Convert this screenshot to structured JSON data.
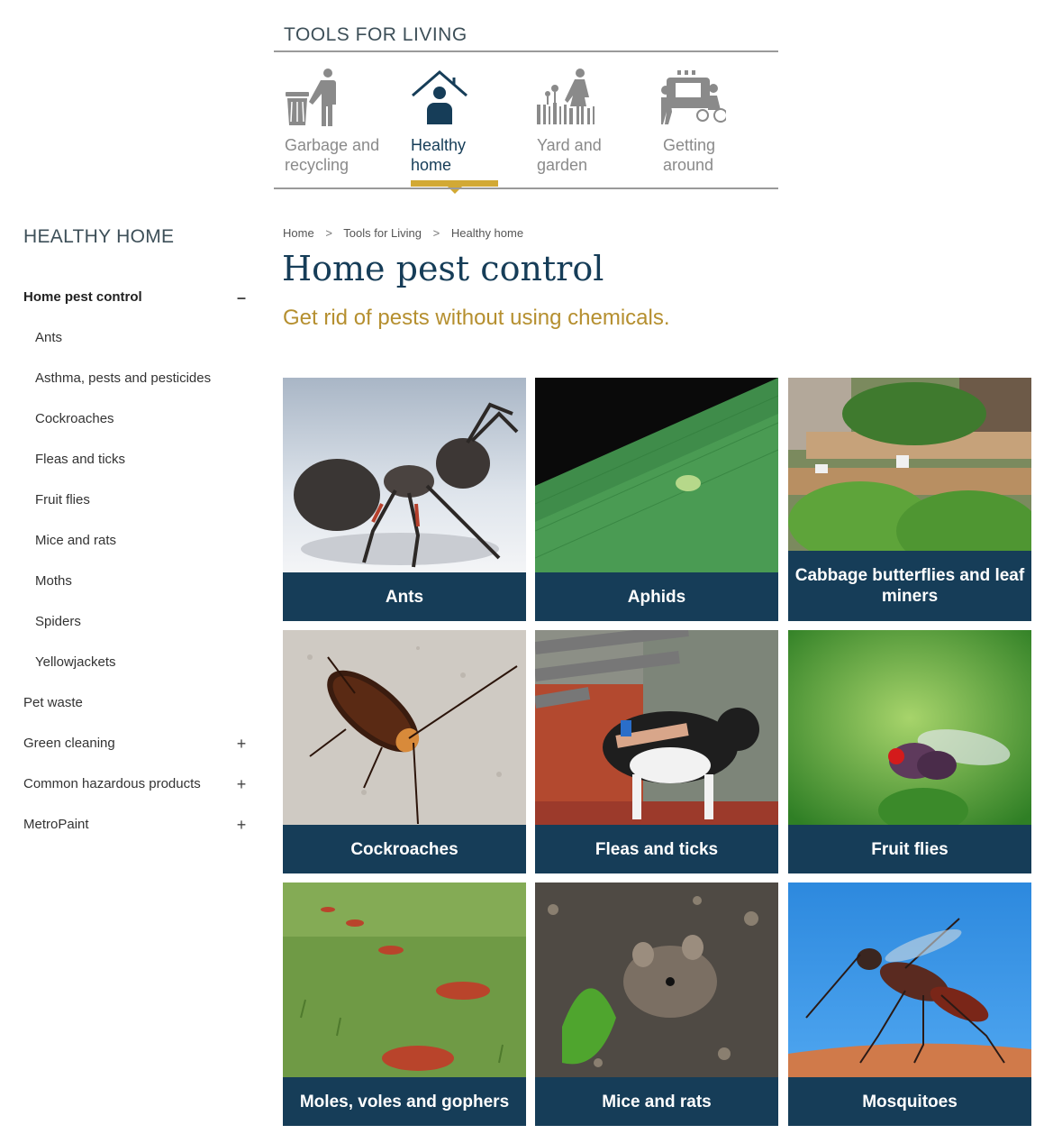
{
  "nav": {
    "title": "TOOLS FOR LIVING",
    "items": [
      {
        "label": "Garbage and\nrecycling",
        "icon": "garbage-recycling-icon"
      },
      {
        "label": "Healthy\nhome",
        "icon": "healthy-home-icon",
        "active": true
      },
      {
        "label": "Yard and\ngarden",
        "icon": "yard-garden-icon"
      },
      {
        "label": "Getting\naround",
        "icon": "getting-around-icon"
      }
    ]
  },
  "sidebar": {
    "title": "HEALTHY HOME",
    "items": [
      {
        "label": "Home pest control",
        "toggle": "–"
      },
      {
        "label": "Ants"
      },
      {
        "label": "Asthma, pests and pesticides"
      },
      {
        "label": "Cockroaches"
      },
      {
        "label": "Fleas and ticks"
      },
      {
        "label": "Fruit flies"
      },
      {
        "label": "Mice and rats"
      },
      {
        "label": "Moths"
      },
      {
        "label": "Spiders"
      },
      {
        "label": "Yellowjackets"
      },
      {
        "label": "Pet waste"
      },
      {
        "label": "Green cleaning",
        "toggle": "+"
      },
      {
        "label": "Common hazardous products",
        "toggle": "+"
      },
      {
        "label": "MetroPaint",
        "toggle": "+"
      }
    ]
  },
  "breadcrumb": {
    "items": [
      "Home",
      "Tools for Living",
      "Healthy home"
    ],
    "separator": ">"
  },
  "page": {
    "title": "Home pest control",
    "subtitle": "Get rid of pests without using chemicals."
  },
  "cards": [
    {
      "label": "Ants"
    },
    {
      "label": "Aphids"
    },
    {
      "label": "Cabbage butterflies and leaf miners"
    },
    {
      "label": "Cockroaches"
    },
    {
      "label": "Fleas and ticks"
    },
    {
      "label": "Fruit flies"
    },
    {
      "label": "Moles, voles and gophers"
    },
    {
      "label": "Mice and rats"
    },
    {
      "label": "Mosquitoes"
    }
  ],
  "colors": {
    "navy": "#163d58",
    "gold": "#d2a935",
    "subtitle_gold": "#b58f2f",
    "gray_icon": "#8a8a8a"
  }
}
